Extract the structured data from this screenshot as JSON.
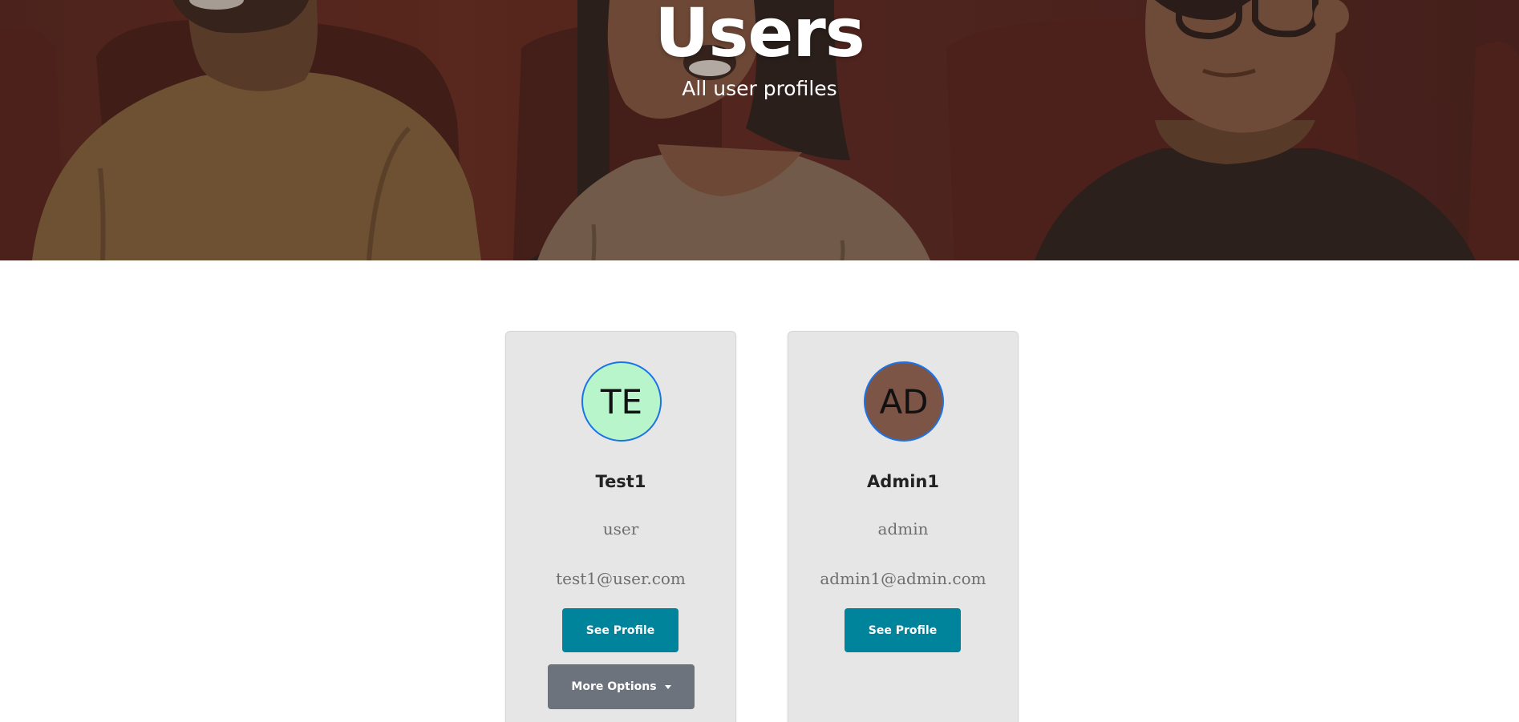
{
  "hero": {
    "title": "Users",
    "subtitle": "All user profiles"
  },
  "users": [
    {
      "initials": "TE",
      "name": "Test1",
      "role": "user",
      "email": "test1@user.com",
      "avatar_color": "#b9f5cb",
      "see_profile_label": "See Profile",
      "more_options_label": "More Options"
    },
    {
      "initials": "AD",
      "name": "Admin1",
      "role": "admin",
      "email": "admin1@admin.com",
      "avatar_color": "#7d5547",
      "see_profile_label": "See Profile"
    }
  ],
  "colors": {
    "primary_button": "#00849b",
    "secondary_button": "#6c737c",
    "avatar_border": "#1a73e8",
    "card_background": "#e6e6e6"
  }
}
